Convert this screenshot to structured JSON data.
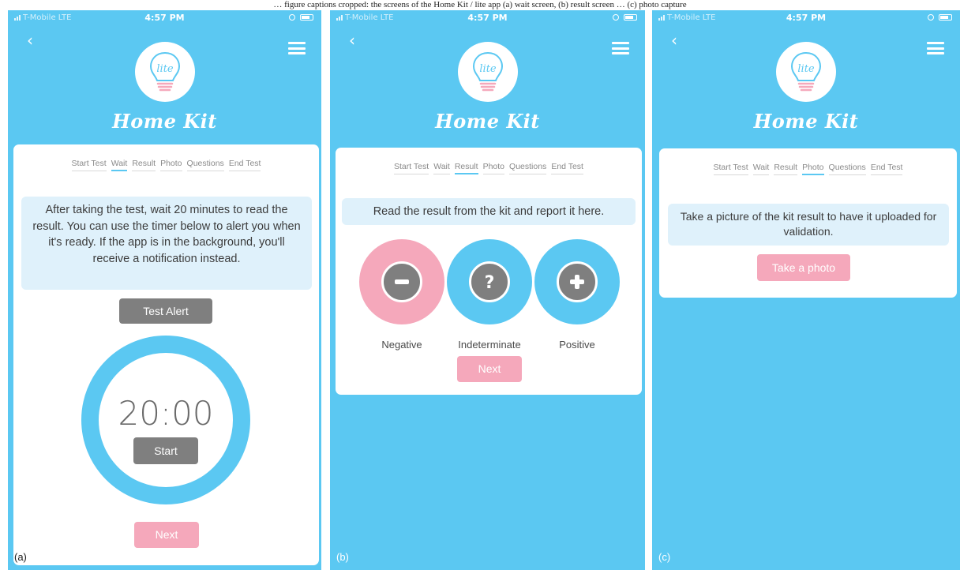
{
  "caption": "… figure captions cropped: the screens of the Home Kit / lite app (a) wait screen, (b) result screen … (c) photo capture",
  "colors": {
    "primary": "#5bc8f2",
    "pink": "#f5a8bb",
    "gray": "#7f7f7f",
    "info_bg": "#dff1fb"
  },
  "status_bar": {
    "carrier": "T-Mobile  LTE",
    "time": "4:57 PM"
  },
  "app": {
    "logo_text": "lite",
    "brand_title": "Home Kit"
  },
  "steps": [
    "Start Test",
    "Wait",
    "Result",
    "Photo",
    "Questions",
    "End Test"
  ],
  "screen_a": {
    "panel_label": "(a)",
    "active_step": "Wait",
    "instructions": "After taking the test, wait 20 minutes to read the result. You can use the timer below to alert you when it's ready. If the app is in the background, you'll receive a notification instead.",
    "test_alert_label": "Test Alert",
    "timer_value": "20:00",
    "start_label": "Start",
    "next_label": "Next"
  },
  "screen_b": {
    "panel_label": "(b)",
    "active_step": "Result",
    "instructions": "Read the result from the kit and report it here.",
    "choices": [
      {
        "label": "Negative",
        "icon": "minus-icon"
      },
      {
        "label": "Indeterminate",
        "icon": "question-icon"
      },
      {
        "label": "Positive",
        "icon": "plus-icon"
      }
    ],
    "next_label": "Next"
  },
  "screen_c": {
    "panel_label": "(c)",
    "active_step": "Photo",
    "instructions": "Take a picture of the kit result to have it uploaded for validation.",
    "photo_label": "Take a photo"
  }
}
